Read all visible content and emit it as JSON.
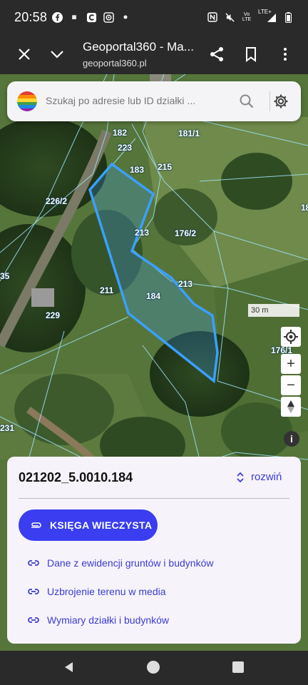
{
  "status_bar": {
    "time": "20:58",
    "left_icons": [
      "facebook-icon",
      "temu-icon",
      "app-c-icon",
      "app-camera-icon",
      "dot-icon"
    ],
    "right_icons": [
      "nfc-icon",
      "mute-icon",
      "volte-icon",
      "lte-signal-icon",
      "battery-icon"
    ],
    "lte_label": "LTE+",
    "volte_label": "Vo LTE"
  },
  "browser": {
    "title": "Geoportal360 - Ma...",
    "url": "geoportal360.pl"
  },
  "search": {
    "placeholder": "Szukaj po adresie lub ID działki ..."
  },
  "map": {
    "scale_label": "30 m",
    "plot_labels": [
      "182",
      "181/1",
      "223",
      "183",
      "215",
      "226/2",
      "18",
      "213",
      "176/2",
      "35",
      "213",
      "211",
      "184",
      "229",
      "176/1",
      "231"
    ],
    "controls": [
      "locate-icon",
      "zoom-in-icon",
      "zoom-out-icon",
      "compass-icon",
      "info-icon"
    ]
  },
  "panel": {
    "parcel_id": "021202_5.0010.184",
    "expand_label": "rozwiń",
    "primary_button": "KSIĘGA WIECZYSTA",
    "links": [
      "Dane z ewidencji gruntów i budynków",
      "Uzbrojenie terenu w media",
      "Wymiary działki i budynków"
    ]
  },
  "colors": {
    "accent": "#3a3ef0",
    "link": "#3c3cd0",
    "parcel_outline": "#3aa0ff"
  }
}
